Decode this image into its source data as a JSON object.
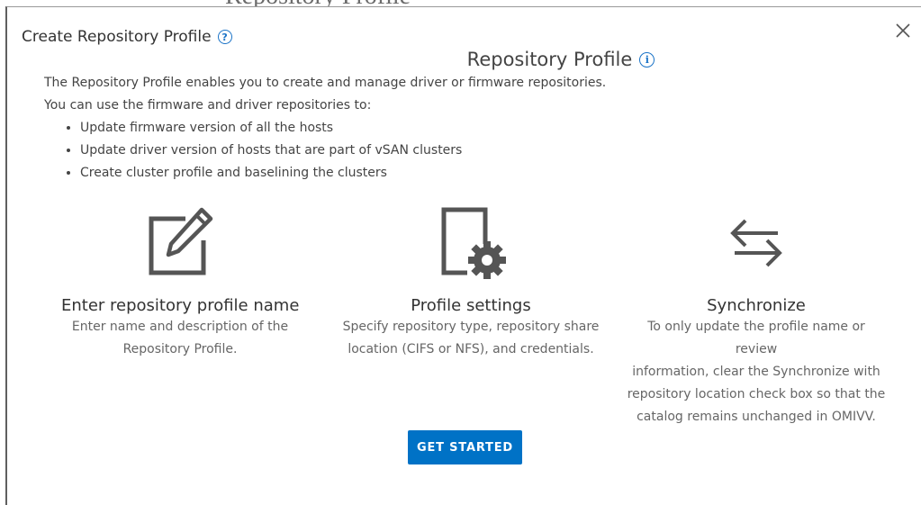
{
  "backdrop": {
    "title": "Repository Profile"
  },
  "dialog": {
    "title": "Create Repository Profile",
    "help_icon": "question-circle-icon",
    "close_icon": "close-x-icon"
  },
  "main": {
    "heading": "Repository Profile",
    "heading_icon": "info-circle-icon",
    "intro_line1": "The Repository Profile enables you to create and manage driver or firmware repositories.",
    "intro_line2": "You can use the firmware and driver repositories to:",
    "bullets": [
      "Update firmware version of all the hosts",
      "Update driver version of hosts that are part of vSAN clusters",
      "Create cluster profile and baselining the clusters"
    ]
  },
  "steps": [
    {
      "icon": "edit-pencil-icon",
      "title": "Enter repository profile name",
      "desc1": "Enter name and description of the",
      "desc2": "Repository Profile."
    },
    {
      "icon": "document-settings-icon",
      "title": "Profile settings",
      "desc1": "Specify repository type, repository share",
      "desc2": "location (CIFS or NFS), and credentials."
    },
    {
      "icon": "sync-arrows-icon",
      "title": "Synchronize",
      "desc1": "To only update the profile name or review",
      "desc2": "information, clear the Synchronize with",
      "desc3": "repository location check box so that the",
      "desc4": "catalog remains unchanged in OMIVV."
    }
  ],
  "actions": {
    "get_started": "GET STARTED"
  },
  "colors": {
    "accent": "#0072c6",
    "help_icon": "#1a73c7"
  }
}
